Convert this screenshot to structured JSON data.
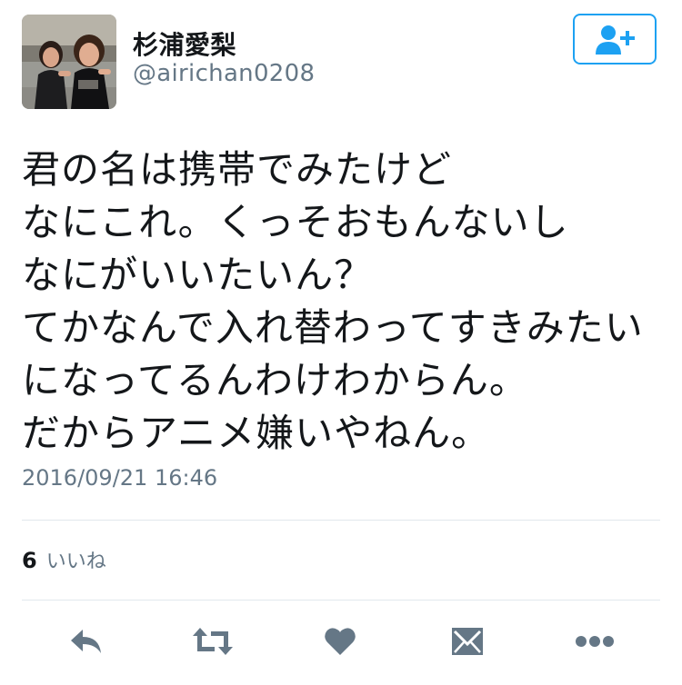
{
  "user": {
    "display_name": "杉浦愛梨",
    "username": "@airichan0208"
  },
  "tweet": {
    "lines": [
      "君の名は携帯でみたけど",
      "なにこれ。くっそおもんないし",
      "なにがいいたいん？",
      "てかなんで入れ替わってすきみたい",
      "になってるんわけわからん。",
      "だからアニメ嫌いやねん。"
    ],
    "timestamp": "2016/09/21 16:46"
  },
  "stats": {
    "likes_count": "6",
    "likes_label": "いいね"
  },
  "icons": {
    "follow": "add-user-icon",
    "reply": "reply-icon",
    "retweet": "retweet-icon",
    "like": "heart-icon",
    "dm": "envelope-icon",
    "more": "more-icon"
  },
  "colors": {
    "accent": "#1da1f2",
    "action_icon": "#657786",
    "secondary_text": "#657786",
    "divider": "#e1e8ed"
  }
}
